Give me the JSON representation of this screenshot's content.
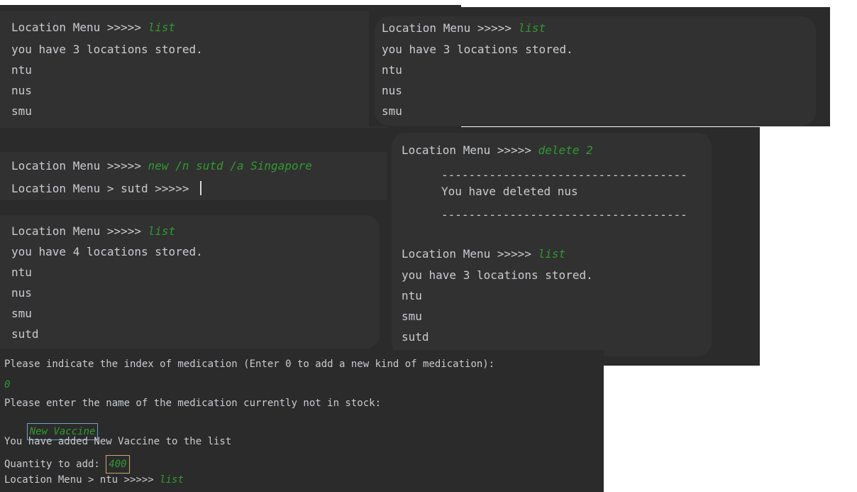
{
  "colors": {
    "terminal_bg": "#2b2b2b",
    "panel_bg": "#313131",
    "text": "#c9ccd1",
    "command": "#2f9a2f",
    "input_box_blue": "#6fa3c8",
    "input_box_orange": "#c9a96a"
  },
  "top_left": {
    "prompt": "Location Menu >>>>> ",
    "command": "list",
    "lines": [
      "you have 3 locations stored.",
      "ntu",
      "nus",
      "smu"
    ]
  },
  "top_right": {
    "prompt": "Location Menu >>>>> ",
    "command": "list",
    "lines": [
      "you have 3 locations stored.",
      "ntu",
      "nus",
      "smu"
    ]
  },
  "new_block": {
    "prompt1": "Location Menu >>>>> ",
    "command1": "new /n sutd /a Singapore",
    "prompt2": "Location Menu > sutd >>>>> "
  },
  "list4": {
    "prompt": "Location Menu >>>>> ",
    "command": "list",
    "lines": [
      "you have 4 locations stored.",
      "ntu",
      "nus",
      "smu",
      "sutd"
    ]
  },
  "delete_block": {
    "prompt": "Location Menu >>>>> ",
    "command": "delete 2",
    "rule": "------------------------------------",
    "message": "You have deleted nus",
    "prompt2": "Location Menu >>>>> ",
    "command2": "list",
    "lines": [
      "you have 3 locations stored.",
      "ntu",
      "smu",
      "sutd"
    ]
  },
  "medication_block": {
    "line1": "Please indicate the index of medication (Enter 0 to add a new kind of medication):",
    "input1": "0",
    "line2": "Please enter the name of the medication currently not in stock:",
    "input2": "New Vaccine",
    "line3": "You have added New Vaccine to the list",
    "line4_label": "Quantity to add: ",
    "input4": "400",
    "prompt5": "Location Menu > ntu >>>>> ",
    "command5": "list"
  }
}
